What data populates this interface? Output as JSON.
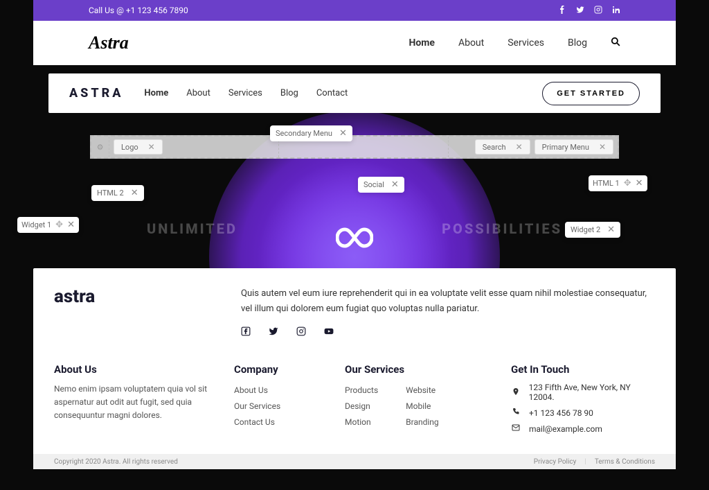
{
  "topbar": {
    "phone_label": "Call Us @ +1 123 456 7890",
    "social_icons": [
      "facebook-f",
      "twitter",
      "instagram",
      "linkedin-in"
    ]
  },
  "primary_nav": {
    "logo": "Astra",
    "menu": [
      {
        "label": "Home",
        "active": true
      },
      {
        "label": "About",
        "active": false
      },
      {
        "label": "Services",
        "active": false
      },
      {
        "label": "Blog",
        "active": false
      }
    ],
    "search_icon": "search"
  },
  "secondary_nav": {
    "logo": "ASTRA",
    "menu": [
      {
        "label": "Home",
        "active": true
      },
      {
        "label": "About",
        "active": false
      },
      {
        "label": "Services",
        "active": false
      },
      {
        "label": "Blog",
        "active": false
      },
      {
        "label": "Contact",
        "active": false
      }
    ],
    "cta": "GET STARTED"
  },
  "background_text": {
    "left": "UNLIMITED",
    "right": "POSSIBILITIES"
  },
  "editor": {
    "floating": {
      "secondary_menu": "Secondary Menu",
      "social": "Social",
      "html1": "HTML 1",
      "html2": "HTML 2",
      "widget1": "Widget 1",
      "widget2": "Widget 2"
    },
    "bar": {
      "logo": "Logo",
      "search": "Search",
      "primary_menu": "Primary Menu"
    }
  },
  "footer": {
    "logo": "astra",
    "intro": "Quis autem vel eum iure reprehenderit qui in ea voluptate velit esse quam nihil molestiae consequatur, vel illum qui dolorem eum fugiat quo voluptas nulla pariatur.",
    "social_icons": [
      "facebook",
      "twitter",
      "instagram",
      "youtube"
    ],
    "about": {
      "heading": "About Us",
      "text": "Nemo enim ipsam voluptatem quia vol sit aspernatur aut odit aut fugit, sed quia consequuntur magni dolores."
    },
    "company": {
      "heading": "Company",
      "links": [
        "About Us",
        "Our Services",
        "Contact Us"
      ]
    },
    "services": {
      "heading": "Our Services",
      "col1": [
        "Products",
        "Design",
        "Motion"
      ],
      "col2": [
        "Website",
        "Mobile",
        "Branding"
      ]
    },
    "touch": {
      "heading": "Get In Touch",
      "address": "123 Fifth Ave, New York,  NY 12004.",
      "phone": "+1 123 456 78 90",
      "email": "mail@example.com"
    },
    "bar": {
      "copyright": "Copyright 2020 Astra. All rights reserved",
      "privacy": "Privacy Policy",
      "terms": "Terms & Conditions"
    }
  }
}
